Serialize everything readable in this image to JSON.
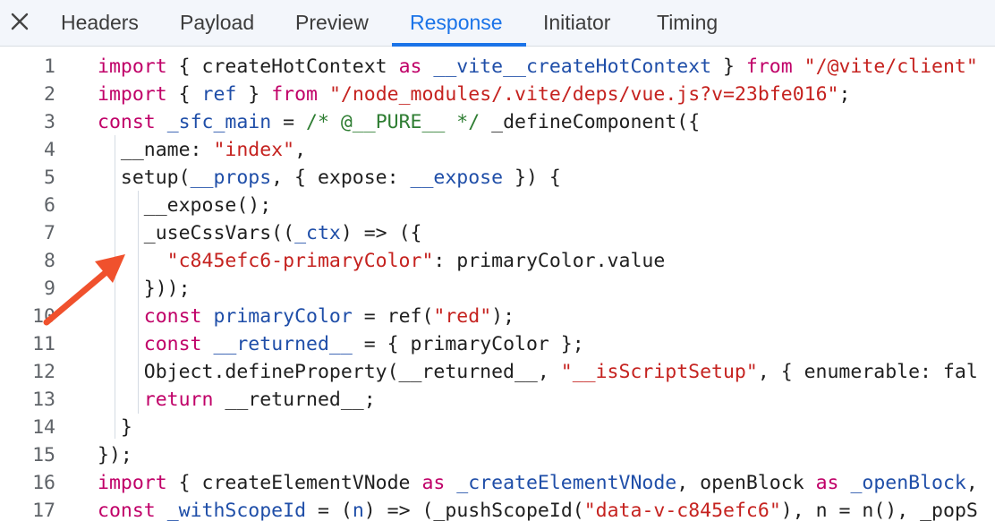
{
  "tabs": [
    {
      "label": "Headers",
      "active": false
    },
    {
      "label": "Payload",
      "active": false
    },
    {
      "label": "Preview",
      "active": false
    },
    {
      "label": "Response",
      "active": true
    },
    {
      "label": "Initiator",
      "active": false
    },
    {
      "label": "Timing",
      "active": false
    }
  ],
  "icons": {
    "close": "close-icon",
    "annotation": "red-arrow-annotation"
  },
  "colors": {
    "accent": "#1a73e8",
    "keyword": "#c00068",
    "string": "#c5221f",
    "comment": "#2e7d32",
    "identifier": "#1f4ea8",
    "arrow": "#f0512d"
  },
  "code": {
    "lines": [
      {
        "n": "1",
        "tokens": [
          [
            "kw",
            "import"
          ],
          [
            "pl",
            " { createHotContext "
          ],
          [
            "kw",
            "as"
          ],
          [
            "pl",
            " "
          ],
          [
            "def",
            "__vite__createHotContext"
          ],
          [
            "pl",
            " } "
          ],
          [
            "kw",
            "from"
          ],
          [
            "pl",
            " "
          ],
          [
            "str",
            "\"/@vite/client\""
          ]
        ]
      },
      {
        "n": "2",
        "tokens": [
          [
            "kw",
            "import"
          ],
          [
            "pl",
            " { "
          ],
          [
            "def",
            "ref"
          ],
          [
            "pl",
            " } "
          ],
          [
            "kw",
            "from"
          ],
          [
            "pl",
            " "
          ],
          [
            "str",
            "\"/node_modules/.vite/deps/vue.js?v=23bfe016\""
          ],
          [
            "pl",
            ";"
          ]
        ]
      },
      {
        "n": "3",
        "tokens": [
          [
            "kw",
            "const"
          ],
          [
            "pl",
            " "
          ],
          [
            "def",
            "_sfc_main"
          ],
          [
            "pl",
            " = "
          ],
          [
            "cm",
            "/* @__PURE__ */"
          ],
          [
            "pl",
            " _defineComponent({"
          ]
        ]
      },
      {
        "n": "4",
        "tokens": [
          [
            "pl",
            "  __name: "
          ],
          [
            "str",
            "\"index\""
          ],
          [
            "pl",
            ","
          ]
        ]
      },
      {
        "n": "5",
        "tokens": [
          [
            "pl",
            "  setup("
          ],
          [
            "def",
            "__props"
          ],
          [
            "pl",
            ", { expose: "
          ],
          [
            "def",
            "__expose"
          ],
          [
            "pl",
            " }) {"
          ]
        ]
      },
      {
        "n": "6",
        "tokens": [
          [
            "pl",
            "    __expose();"
          ]
        ]
      },
      {
        "n": "7",
        "tokens": [
          [
            "pl",
            "    _useCssVars(("
          ],
          [
            "def",
            "_ctx"
          ],
          [
            "pl",
            ") => ({"
          ]
        ]
      },
      {
        "n": "8",
        "tokens": [
          [
            "pl",
            "      "
          ],
          [
            "str",
            "\"c845efc6-primaryColor\""
          ],
          [
            "pl",
            ": primaryColor.value"
          ]
        ]
      },
      {
        "n": "9",
        "tokens": [
          [
            "pl",
            "    }));"
          ]
        ]
      },
      {
        "n": "10",
        "tokens": [
          [
            "pl",
            "    "
          ],
          [
            "kw",
            "const"
          ],
          [
            "pl",
            " "
          ],
          [
            "def",
            "primaryColor"
          ],
          [
            "pl",
            " = ref("
          ],
          [
            "str",
            "\"red\""
          ],
          [
            "pl",
            ");"
          ]
        ]
      },
      {
        "n": "11",
        "tokens": [
          [
            "pl",
            "    "
          ],
          [
            "kw",
            "const"
          ],
          [
            "pl",
            " "
          ],
          [
            "def",
            "__returned__"
          ],
          [
            "pl",
            " = { primaryColor };"
          ]
        ]
      },
      {
        "n": "12",
        "tokens": [
          [
            "pl",
            "    Object.defineProperty(__returned__, "
          ],
          [
            "str",
            "\"__isScriptSetup\""
          ],
          [
            "pl",
            ", { enumerable: fal"
          ]
        ]
      },
      {
        "n": "13",
        "tokens": [
          [
            "pl",
            "    "
          ],
          [
            "kw",
            "return"
          ],
          [
            "pl",
            " __returned__;"
          ]
        ]
      },
      {
        "n": "14",
        "tokens": [
          [
            "pl",
            "  }"
          ]
        ]
      },
      {
        "n": "15",
        "tokens": [
          [
            "pl",
            "});"
          ]
        ]
      },
      {
        "n": "16",
        "tokens": [
          [
            "kw",
            "import"
          ],
          [
            "pl",
            " { createElementVNode "
          ],
          [
            "kw",
            "as"
          ],
          [
            "pl",
            " "
          ],
          [
            "def",
            "_createElementVNode"
          ],
          [
            "pl",
            ", openBlock "
          ],
          [
            "kw",
            "as"
          ],
          [
            "pl",
            " "
          ],
          [
            "def",
            "_openBlock"
          ],
          [
            "pl",
            ","
          ]
        ]
      },
      {
        "n": "17",
        "tokens": [
          [
            "kw",
            "const"
          ],
          [
            "pl",
            " "
          ],
          [
            "def",
            "_withScopeId"
          ],
          [
            "pl",
            " = ("
          ],
          [
            "def",
            "n"
          ],
          [
            "pl",
            ") => (_pushScopeId("
          ],
          [
            "str",
            "\"data-v-c845efc6\""
          ],
          [
            "pl",
            "), n = n(), _popS"
          ]
        ]
      }
    ]
  }
}
